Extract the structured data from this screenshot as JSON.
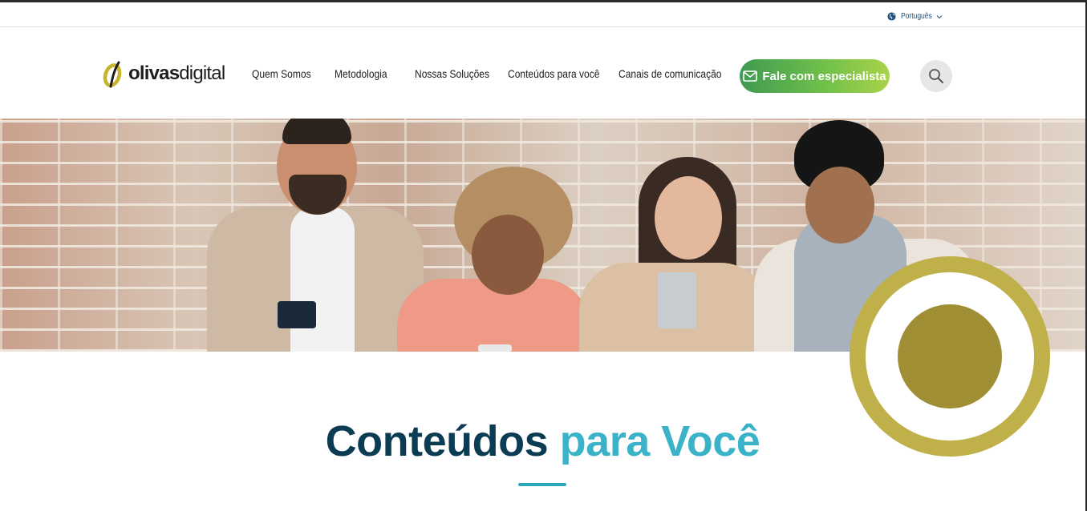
{
  "utility_bar": {
    "language": {
      "label": "Português",
      "icon": "globe-icon",
      "chevron": "chevron-down-icon"
    }
  },
  "header": {
    "logo": {
      "text_bold": "olivas",
      "text_light": "digital",
      "mark_colors": [
        "#c7b42c",
        "#1d1d1b"
      ]
    },
    "nav": [
      {
        "label": "Quem Somos"
      },
      {
        "label": "Metodologia"
      },
      {
        "label": "Nossas Soluções"
      },
      {
        "label": "Conteúdos para você"
      },
      {
        "label": "Canais de comunicação"
      }
    ],
    "cta": {
      "label": "Fale com especialista",
      "icon": "mail-icon",
      "colors": [
        "#3f9a52",
        "#a9d34a"
      ]
    },
    "search": {
      "icon": "search-icon"
    }
  },
  "hero": {
    "image": "four young people smiling and using smartphones in front of a brick wall"
  },
  "section": {
    "title_part1": "Conteúdos",
    "title_part2": "para Você",
    "colors": {
      "dark": "#0c3c54",
      "light": "#3ab2c8"
    }
  },
  "decor": {
    "ring_color": "#bfb049",
    "core_color": "#a08e35"
  }
}
